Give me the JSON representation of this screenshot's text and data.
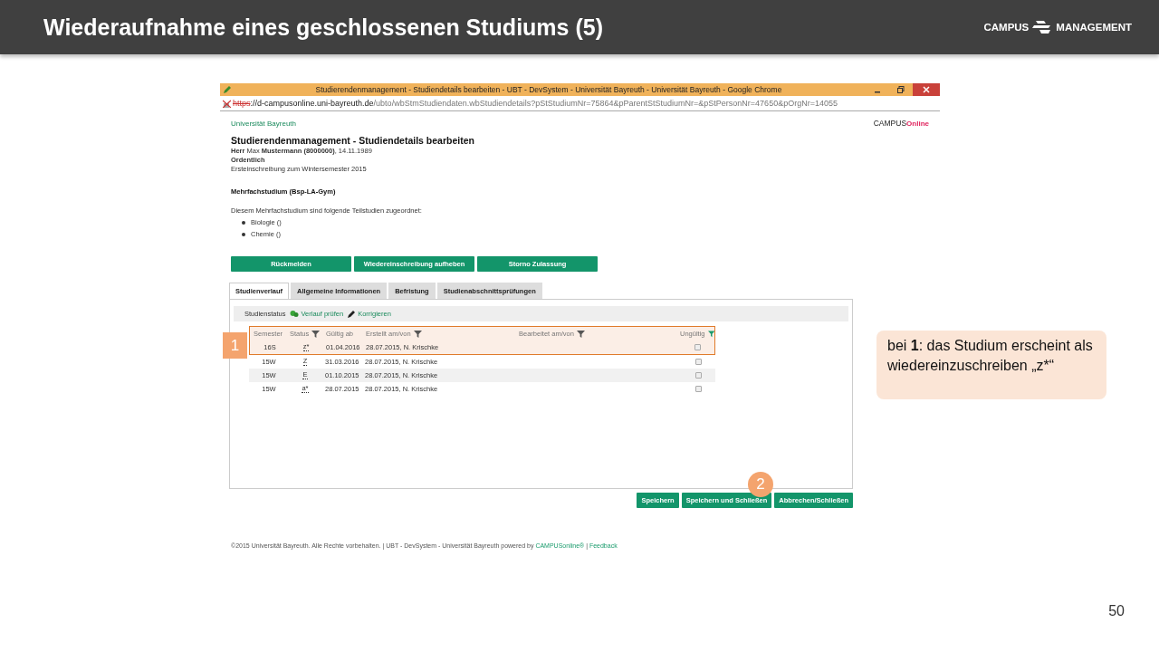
{
  "slide": {
    "title": "Wiederaufnahme eines geschlossenen Studiums (5)",
    "logo": {
      "left": "CAMPUS",
      "right": "MANAGEMENT"
    },
    "page_number": "50"
  },
  "browser": {
    "title": "Studierendenmanagement - Studiendetails bearbeiten - UBT - DevSystem - Universität Bayreuth - Universität Bayreuth - Google Chrome",
    "url": {
      "scheme": "https",
      "host": "://d-campusonline.uni-bayreuth.de",
      "path": "/ubto/wbStmStudiendaten.wbStudiendetails?pStStudiumNr=75864&pParentStStudiumNr=&pStPersonNr=47650&pOrgNr=14055"
    }
  },
  "page": {
    "university": "Universität Bayreuth",
    "logo": {
      "left": "CAMPUS",
      "right": "Online"
    },
    "heading": "Studierendenmanagement - Studiendetails bearbeiten",
    "person": "**Herr** Max **Mustermann (8000000)**, 14.11.1989",
    "category": "Ordentlich",
    "enrollment": "Ersteinschreibung zum Wintersemester 2015",
    "section_title": "Mehrfachstudium (Bsp-LA-Gym)",
    "intro": "Diesem Mehrfachstudium sind folgende Teilstudien zugeordnet:",
    "sub_studies": [
      "Biologie ()",
      "Chemie ()"
    ],
    "actions": [
      "Rückmelden",
      "Wiedereinschreibung aufheben",
      "Storno Zulassung"
    ],
    "tabs": [
      {
        "label": "Studienverlauf",
        "selected": true
      },
      {
        "label": "Allgemeine Informationen",
        "selected": false
      },
      {
        "label": "Befristung",
        "selected": false
      },
      {
        "label": "Studienabschnittsprüfungen",
        "selected": false
      }
    ],
    "toolbar": {
      "label": "Studienstatus",
      "links": [
        {
          "kind": "check",
          "label": "Verlauf prüfen"
        },
        {
          "kind": "edit",
          "label": "Korrigieren"
        }
      ]
    },
    "table": {
      "columns": [
        {
          "label": "Semester",
          "kind": "plain"
        },
        {
          "label": "Status",
          "kind": "filterable",
          "filter_active": false
        },
        {
          "label": "Gültig ab",
          "kind": "plain"
        },
        {
          "label": "Erstellt am/von",
          "kind": "filterable",
          "filter_active": false
        },
        {
          "label": "Bearbeitet am/von",
          "kind": "filterable",
          "filter_active": false
        },
        {
          "label": "Ungültig",
          "kind": "filterable",
          "filter_active": true
        }
      ],
      "rows": [
        {
          "semester": "16S",
          "status": "z*",
          "valid_from": "01.04.2016",
          "created": "28.07.2015, N. Krischke",
          "invalid": false,
          "framed": true
        },
        {
          "semester": "15W",
          "status": "Z",
          "valid_from": "31.03.2016",
          "created": "28.07.2015, N. Krischke",
          "invalid": false,
          "framed": false
        },
        {
          "semester": "15W",
          "status": "E",
          "valid_from": "01.10.2015",
          "created": "28.07.2015, N. Krischke",
          "invalid": false,
          "framed": false
        },
        {
          "semester": "15W",
          "status": "a*",
          "valid_from": "28.07.2015",
          "created": "28.07.2015, N. Krischke",
          "invalid": false,
          "framed": false
        }
      ]
    },
    "buttons": [
      "Speichern",
      "Speichern und Schließen",
      "Abbrechen/Schließen"
    ],
    "footer": {
      "text": "©2015 Universität Bayreuth. Alle Rechte vorbehalten. | UBT - DevSystem - Universität Bayreuth powered by ",
      "link": "CAMPUSonline®",
      "separator": " | ",
      "feedback": "Feedback"
    }
  },
  "annotations": {
    "frame_badge": "1",
    "button_badge": "2",
    "callout": "bei **1**: das Studium erscheint als wiedereinzuschreiben „z*“"
  }
}
